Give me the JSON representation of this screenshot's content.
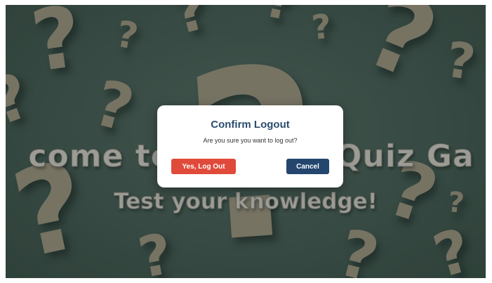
{
  "background": {
    "welcome_title": "come to",
    "welcome_title_right": "Quiz Ga",
    "subtitle": "Test your knowledge!",
    "decoration": "question-mark-pattern",
    "colors": {
      "background": "#3d524b",
      "question_marks": "#8a8472"
    }
  },
  "dialog": {
    "title": "Confirm Logout",
    "message": "Are you sure you want to log out?",
    "confirm_label": "Yes, Log Out",
    "cancel_label": "Cancel",
    "colors": {
      "title": "#2c4d6e",
      "confirm": "#e04a3a",
      "cancel": "#24466e"
    }
  }
}
